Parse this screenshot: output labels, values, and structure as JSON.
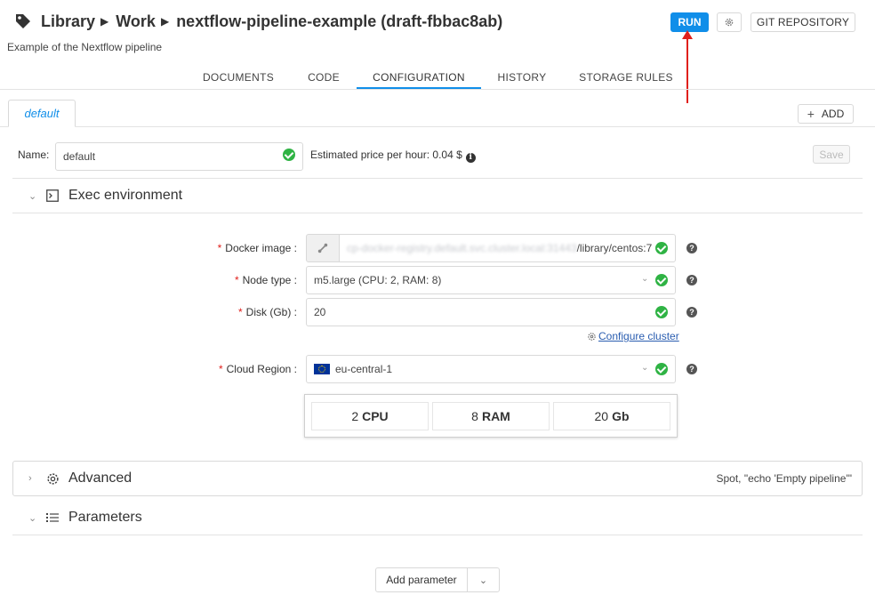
{
  "breadcrumb": {
    "items": [
      "Library",
      "Work",
      "nextflow-pipeline-example (draft-fbbac8ab)"
    ]
  },
  "description": "Example of the Nextflow pipeline",
  "header_buttons": {
    "run": "RUN",
    "git": "GIT REPOSITORY"
  },
  "tabs": [
    "DOCUMENTS",
    "CODE",
    "CONFIGURATION",
    "HISTORY",
    "STORAGE RULES"
  ],
  "active_tab": "CONFIGURATION",
  "config_tabs": {
    "items": [
      "default"
    ],
    "add_label": "ADD"
  },
  "name_row": {
    "label": "Name:",
    "value": "default",
    "price_label": "Estimated price per hour: 0.04 $",
    "save_label": "Save"
  },
  "exec_env": {
    "title": "Exec environment",
    "docker_image": {
      "label": "Docker image",
      "registry": "cp-docker-registry.default.svc.cluster.local:31443",
      "value_suffix": "/library/centos:7"
    },
    "node_type": {
      "label": "Node type",
      "value": "m5.large (CPU: 2, RAM: 8)"
    },
    "disk": {
      "label": "Disk (Gb)",
      "value": "20"
    },
    "configure_cluster": "Configure cluster",
    "cloud_region": {
      "label": "Cloud Region",
      "value": "eu-central-1"
    },
    "summary": {
      "cpu_value": "2",
      "cpu_unit": "CPU",
      "ram_value": "8",
      "ram_unit": "RAM",
      "disk_value": "20",
      "disk_unit": "Gb"
    }
  },
  "advanced": {
    "title": "Advanced",
    "summary": "Spot,  \"echo 'Empty pipeline'\""
  },
  "parameters": {
    "title": "Parameters",
    "add_label": "Add parameter"
  },
  "colors": {
    "primary": "#108ee9",
    "success": "#2fb344",
    "annotation_arrow": "#e0201c"
  }
}
